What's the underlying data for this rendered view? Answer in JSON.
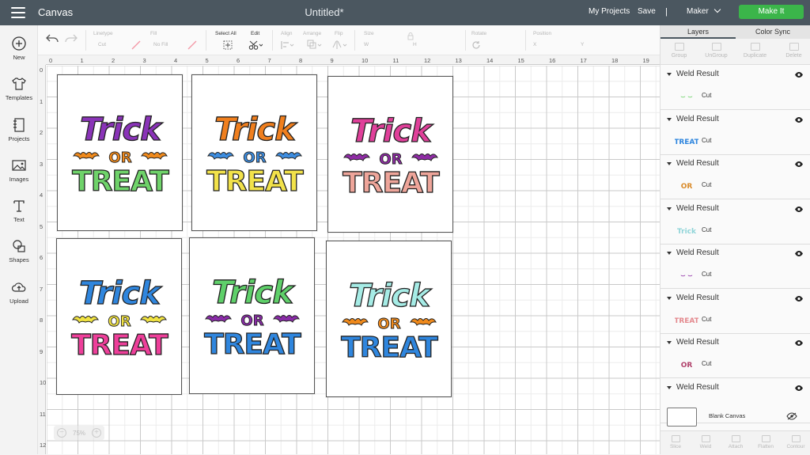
{
  "topbar": {
    "app_title": "Canvas",
    "doc_title": "Untitled*",
    "my_projects": "My Projects",
    "save": "Save",
    "divider": "|",
    "machine": "Maker",
    "make_it": "Make It"
  },
  "leftrail": {
    "items": [
      {
        "label": "New",
        "icon": "plus-circle-icon"
      },
      {
        "label": "Templates",
        "icon": "tshirt-icon"
      },
      {
        "label": "Projects",
        "icon": "notebook-icon"
      },
      {
        "label": "Images",
        "icon": "image-icon"
      },
      {
        "label": "Text",
        "icon": "text-t-icon"
      },
      {
        "label": "Shapes",
        "icon": "shapes-icon"
      },
      {
        "label": "Upload",
        "icon": "cloud-upload-icon"
      }
    ]
  },
  "toolbar": {
    "linetype_label": "Linetype",
    "linetype_value": "Cut",
    "fill_label": "Fill",
    "fill_value": "No Fill",
    "select_all": "Select All",
    "edit": "Edit",
    "align": "Align",
    "arrange": "Arrange",
    "flip": "Flip",
    "size": "Size",
    "size_w": "W",
    "size_h": "H",
    "rotate": "Rotate",
    "position": "Position",
    "pos_x": "X",
    "pos_y": "Y"
  },
  "rulers": {
    "top": [
      "0",
      "1",
      "2",
      "3",
      "4",
      "5",
      "6",
      "7",
      "8",
      "9",
      "10",
      "11",
      "12",
      "13",
      "14",
      "15",
      "16",
      "17",
      "18",
      "19"
    ],
    "left": [
      "0",
      "1",
      "2",
      "3",
      "4",
      "5",
      "6",
      "7",
      "8",
      "9",
      "10",
      "11",
      "12"
    ]
  },
  "canvas": {
    "zoom": "75%",
    "designs": [
      {
        "line1": "Trick",
        "line2": "OR",
        "line3": "TREAT",
        "c1": "#8a34b8",
        "c2": "#f08a1c",
        "c3": "#6fd36a"
      },
      {
        "line1": "Trick",
        "line2": "OR",
        "line3": "TREAT",
        "c1": "#f07f1e",
        "c2": "#3d8de0",
        "c3": "#f2e24a"
      },
      {
        "line1": "Trick",
        "line2": "OR",
        "line3": "TREAT",
        "c1": "#e0409a",
        "c2": "#8f2ca5",
        "c3": "#eea59a"
      },
      {
        "line1": "Trick",
        "line2": "OR",
        "line3": "TREAT",
        "c1": "#2f86de",
        "c2": "#f1e342",
        "c3": "#ee3f9a"
      },
      {
        "line1": "Trick",
        "line2": "OR",
        "line3": "TREAT",
        "c1": "#5fd06a",
        "c2": "#8a2ca8",
        "c3": "#2f86de"
      },
      {
        "line1": "Trick",
        "line2": "OR",
        "line3": "TREAT",
        "c1": "#a6ece6",
        "c2": "#f08a1c",
        "c3": "#2f86de"
      }
    ]
  },
  "panel": {
    "tab_layers": "Layers",
    "tab_colorsync": "Color Sync",
    "tools": [
      "Group",
      "UnGroup",
      "Duplicate",
      "Delete"
    ],
    "layers": [
      {
        "name": "Weld Result",
        "op": "Cut",
        "thumb_color": "#6fd36a",
        "thumb_text": "⌣ ⌣"
      },
      {
        "name": "Weld Result",
        "op": "Cut",
        "thumb_color": "#2f86de",
        "thumb_text": "TREAT"
      },
      {
        "name": "Weld Result",
        "op": "Cut",
        "thumb_color": "#d98a28",
        "thumb_text": "OR"
      },
      {
        "name": "Weld Result",
        "op": "Cut",
        "thumb_color": "#8fd4d8",
        "thumb_text": "Trick"
      },
      {
        "name": "Weld Result",
        "op": "Cut",
        "thumb_color": "#8f2ca5",
        "thumb_text": "⌣ ⌣"
      },
      {
        "name": "Weld Result",
        "op": "Cut",
        "thumb_color": "#e48a8f",
        "thumb_text": "TREAT"
      },
      {
        "name": "Weld Result",
        "op": "Cut",
        "thumb_color": "#b0406a",
        "thumb_text": "OR"
      },
      {
        "name": "Weld Result",
        "op": "",
        "thumb_color": "",
        "thumb_text": ""
      }
    ],
    "blank_canvas": "Blank Canvas",
    "bottom_tools": [
      "Slice",
      "Weld",
      "Attach",
      "Flatten",
      "Contour"
    ]
  }
}
